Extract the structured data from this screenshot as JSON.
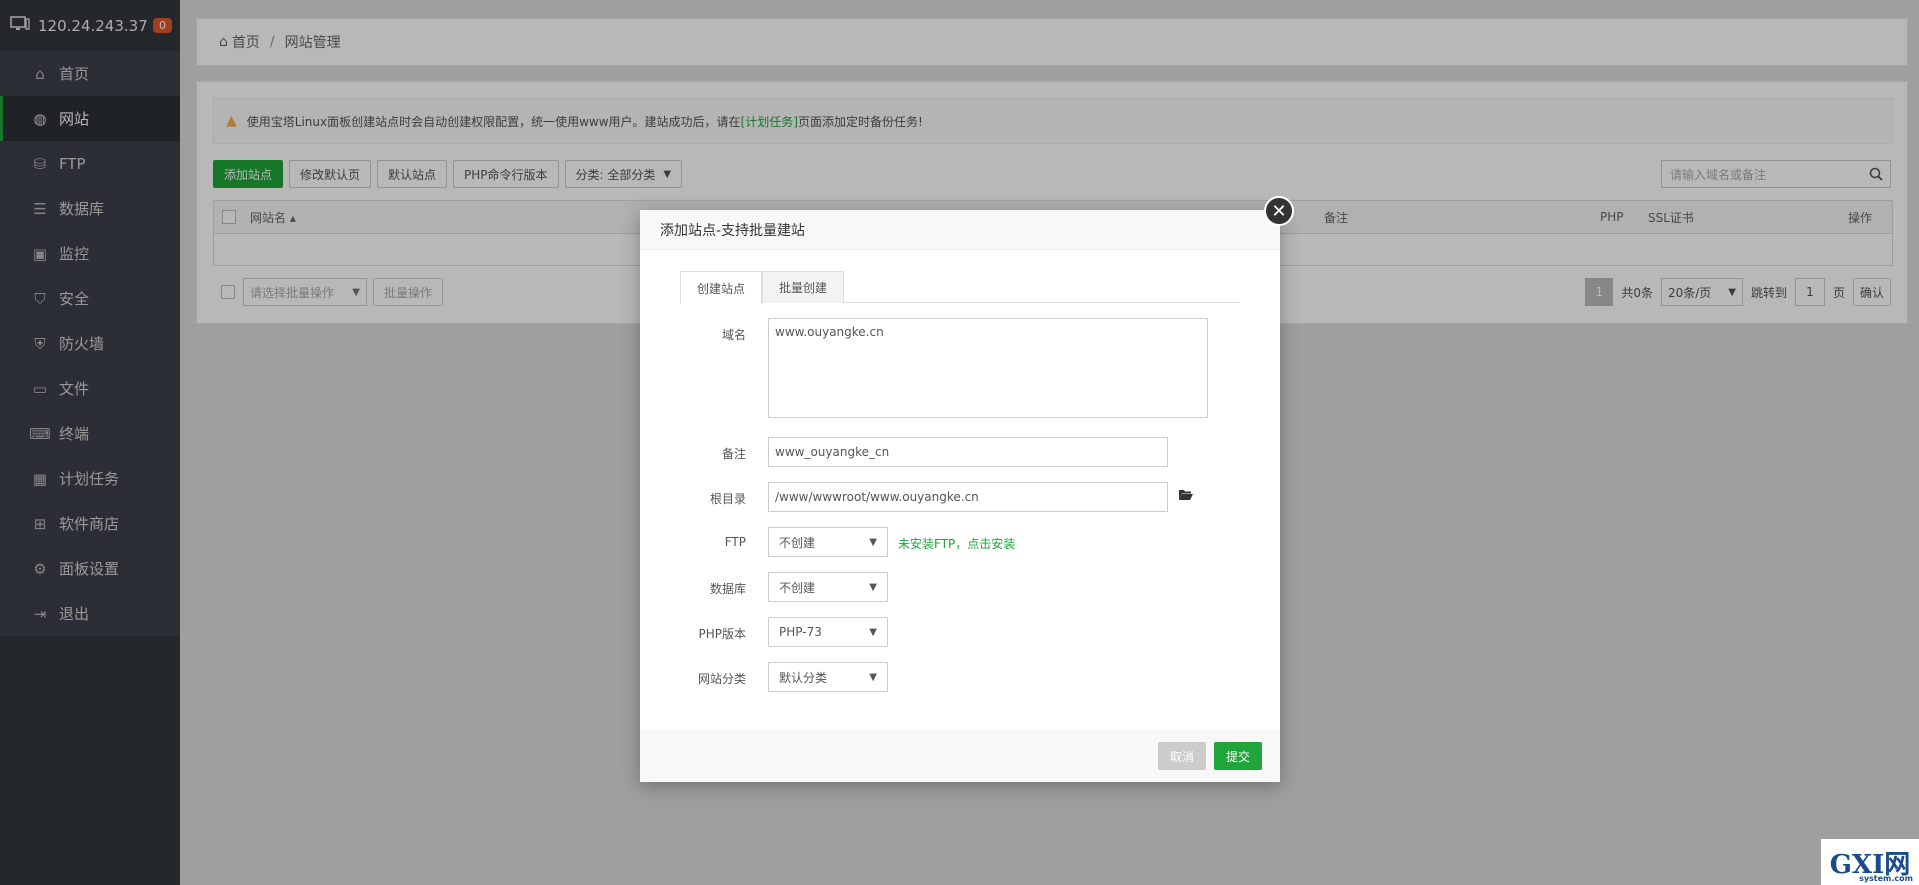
{
  "sidebar": {
    "ip": "120.24.243.37",
    "badge": "0",
    "items": [
      {
        "label": "首页",
        "icon": "home-icon"
      },
      {
        "label": "网站",
        "icon": "globe-icon",
        "active": true
      },
      {
        "label": "FTP",
        "icon": "ftp-icon"
      },
      {
        "label": "数据库",
        "icon": "database-icon"
      },
      {
        "label": "监控",
        "icon": "monitor-icon"
      },
      {
        "label": "安全",
        "icon": "shield-icon"
      },
      {
        "label": "防火墙",
        "icon": "firewall-icon"
      },
      {
        "label": "文件",
        "icon": "folder-icon"
      },
      {
        "label": "终端",
        "icon": "terminal-icon"
      },
      {
        "label": "计划任务",
        "icon": "calendar-icon"
      },
      {
        "label": "软件商店",
        "icon": "apps-icon"
      },
      {
        "label": "面板设置",
        "icon": "gear-icon"
      },
      {
        "label": "退出",
        "icon": "logout-icon"
      }
    ]
  },
  "breadcrumb": {
    "home": "首页",
    "sep": "/",
    "current": "网站管理"
  },
  "notice": {
    "before": "使用宝塔Linux面板创建站点时会自动创建权限配置，统一使用www用户。建站成功后，请在",
    "link": "[计划任务]",
    "after": "页面添加定时备份任务!"
  },
  "toolbar": {
    "add_site": "添加站点",
    "edit_default_page": "修改默认页",
    "default_site": "默认站点",
    "php_cli": "PHP命令行版本",
    "category": "分类: 全部分类"
  },
  "search": {
    "placeholder": "请输入域名或备注"
  },
  "table": {
    "col_name": "网站名 ▴",
    "col_remark": "备注",
    "col_php": "PHP",
    "col_ssl": "SSL证书",
    "col_ops": "操作"
  },
  "bulk": {
    "select_placeholder": "请选择批量操作",
    "button": "批量操作"
  },
  "pager": {
    "current": "1",
    "total": "共0条",
    "per_page": "20条/页",
    "goto": "跳转到",
    "page_input": "1",
    "page_unit": "页",
    "confirm": "确认"
  },
  "modal": {
    "title": "添加站点-支持批量建站",
    "tabs": [
      "创建站点",
      "批量创建"
    ],
    "domain_label": "域名",
    "domain_value": "www.ouyangke.cn",
    "remark_label": "备注",
    "remark_value": "www_ouyangke_cn",
    "root_label": "根目录",
    "root_value": "/www/wwwroot/www.ouyangke.cn",
    "ftp_label": "FTP",
    "ftp_value": "不创建",
    "ftp_hint": "未安装FTP，点击安装",
    "db_label": "数据库",
    "db_value": "不创建",
    "php_label": "PHP版本",
    "php_value": "PHP-73",
    "cat_label": "网站分类",
    "cat_value": "默认分类",
    "cancel": "取消",
    "submit": "提交"
  },
  "watermark": {
    "text": "GXI网",
    "sub": "system.com"
  }
}
